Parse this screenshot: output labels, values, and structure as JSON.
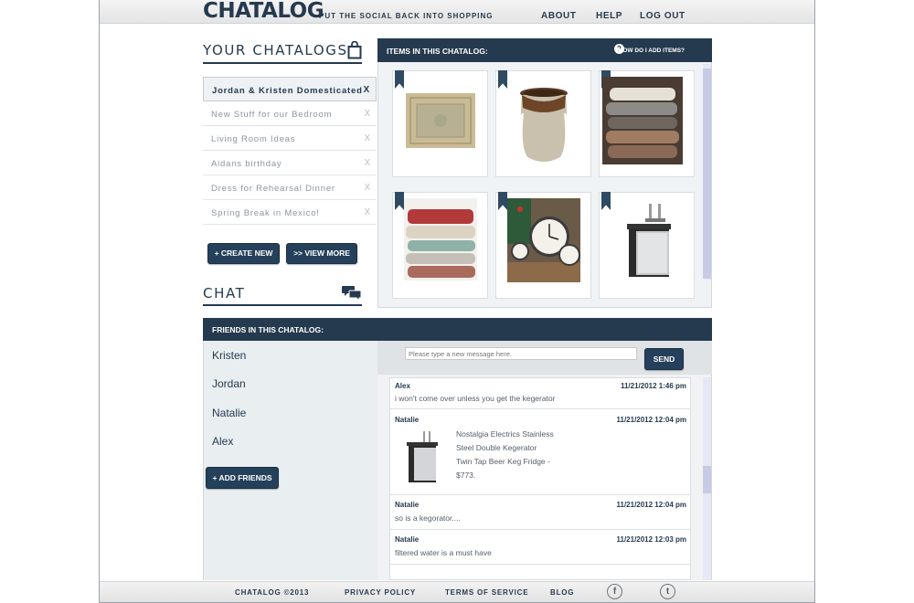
{
  "header": {
    "logo": "CHATALOG",
    "tagline": "PUT THE SOCIAL BACK INTO SHOPPING",
    "nav": {
      "about": "ABOUT",
      "help": "HELP",
      "logout": "LOG OUT"
    }
  },
  "sidebar": {
    "title": "YOUR CHATALOGS",
    "catalogs": [
      {
        "label": "Jordan & Kristen Domesticated",
        "remove": "X"
      },
      {
        "label": "New Stuff for our Bedroom",
        "remove": "X"
      },
      {
        "label": "Living Room Ideas",
        "remove": "X"
      },
      {
        "label": "Aidans birthday",
        "remove": "X"
      },
      {
        "label": "Dress for Rehearsal Dinner",
        "remove": "X"
      },
      {
        "label": "Spring Break in Mexico!",
        "remove": "X"
      }
    ],
    "create_label": "+ CREATE NEW",
    "view_more_label": ">> VIEW MORE",
    "chat_title": "CHAT"
  },
  "items": {
    "heading": "ITEMS IN THIS CHATALOG:",
    "help_icon": "?",
    "help_label": "HOW DO I ADD ITEMS?",
    "products": [
      {
        "icon": "rug-icon"
      },
      {
        "icon": "crock-icon"
      },
      {
        "icon": "blankets-icon"
      },
      {
        "icon": "throws-icon"
      },
      {
        "icon": "clocks-icon"
      },
      {
        "icon": "kegerator-icon"
      }
    ]
  },
  "friends": {
    "heading": "FRIENDS IN THIS CHATALOG:",
    "names": [
      "Kristen",
      "Jordan",
      "Natalie",
      "Alex"
    ],
    "add_label": "+ ADD FRIENDS"
  },
  "chat": {
    "placeholder": "Please type a new message here.",
    "send_label": "SEND",
    "messages": [
      {
        "author": "Alex",
        "time": "11/21/2012 1:46 pm",
        "text": "i won't come over unless you get the kegerator"
      },
      {
        "author": "Natalie",
        "time": "11/21/2012 12:04 pm",
        "product_lines": [
          "Nostalgia Electrics Stainless",
          "Steel Double Kegerator",
          "Twin Tap Beer Keg Fridge -",
          "$773."
        ]
      },
      {
        "author": "Natalie",
        "time": "11/21/2012 12:04 pm",
        "text": "so is a kegorator...."
      },
      {
        "author": "Natalie",
        "time": "11/21/2012 12:03 pm",
        "text": "filtered water is a must have"
      }
    ]
  },
  "footer": {
    "copyright": "CHATALOG ©2013",
    "privacy": "PRIVACY POLICY",
    "terms": "TERMS OF SERVICE",
    "blog": "BLOG",
    "facebook_glyph": "f",
    "twitter_glyph": "t"
  },
  "colors": {
    "brand_navy": "#253a4f",
    "panel_bg": "#f0f3f5",
    "scroll_thumb": "#c8cbe6"
  }
}
